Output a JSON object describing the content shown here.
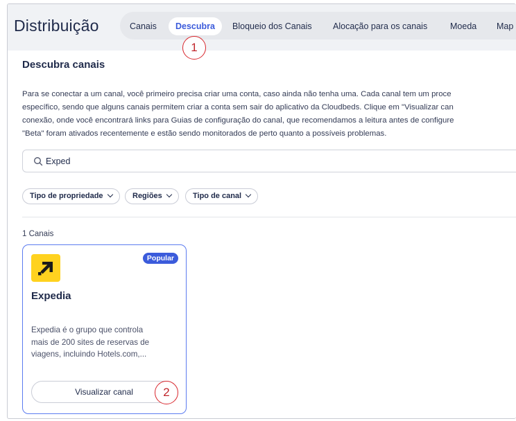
{
  "header": {
    "title": "Distribuição",
    "tabs": [
      {
        "label": "Canais",
        "active": false
      },
      {
        "label": "Descubra",
        "active": true
      },
      {
        "label": "Bloqueio dos Canais",
        "active": false
      },
      {
        "label": "Alocação para os canais",
        "active": false
      },
      {
        "label": "Moeda",
        "active": false
      },
      {
        "label": "Map",
        "active": false
      }
    ]
  },
  "callouts": [
    "1",
    "2"
  ],
  "main": {
    "section_title": "Descubra canais",
    "description_lines": [
      "Para se conectar a um canal, você primeiro precisa criar uma conta, caso ainda não tenha uma. Cada canal tem um proce",
      "específico, sendo que alguns canais permitem criar a conta sem sair do aplicativo da Cloudbeds. Clique em \"Visualizar can",
      "conexão, onde você encontrará links para Guias de configuração do canal, que recomendamos a leitura antes de configure",
      "\"Beta\" foram ativados recentemente e estão sendo monitorados de perto quanto a possíveis problemas."
    ],
    "search": {
      "value": "Exped",
      "icon": "search-icon"
    },
    "filters": [
      {
        "label": "Tipo de propriedade"
      },
      {
        "label": "Regiões"
      },
      {
        "label": "Tipo de canal"
      }
    ],
    "result_count": "1 Canais"
  },
  "card": {
    "badge": "Popular",
    "title": "Expedia",
    "description_lines": [
      "Expedia é o grupo que controla",
      "mais de 200 sites de reservas de",
      "viagens, incluindo Hotels.com,..."
    ],
    "button_label": "Visualizar canal",
    "logo_icon": "expedia-arrow-icon",
    "logo_color": "#ffd21f"
  },
  "colors": {
    "accent": "#3b5bdb",
    "callout": "#d9262c"
  }
}
